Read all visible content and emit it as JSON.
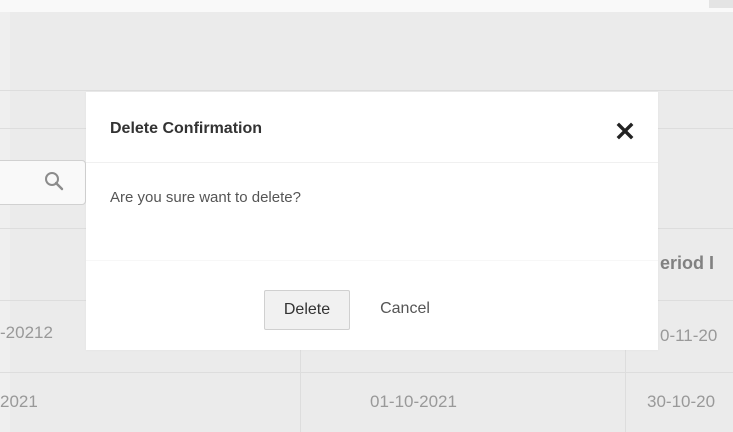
{
  "modal": {
    "title": "Delete Confirmation",
    "message": "Are you sure want to delete?",
    "delete_label": "Delete",
    "cancel_label": "Cancel"
  },
  "table": {
    "partial_header": "eriod I",
    "rows": [
      [
        "-20212",
        "",
        "0-11-20"
      ],
      [
        "2021",
        "01-10-2021",
        "30-10-20"
      ]
    ]
  },
  "icons": {
    "search": "search-icon",
    "close": "close-icon"
  },
  "colors": {
    "modal_bg": "#ffffff",
    "overlay": "#f3f3f3",
    "delete_button_bg": "#f1f1f1"
  }
}
